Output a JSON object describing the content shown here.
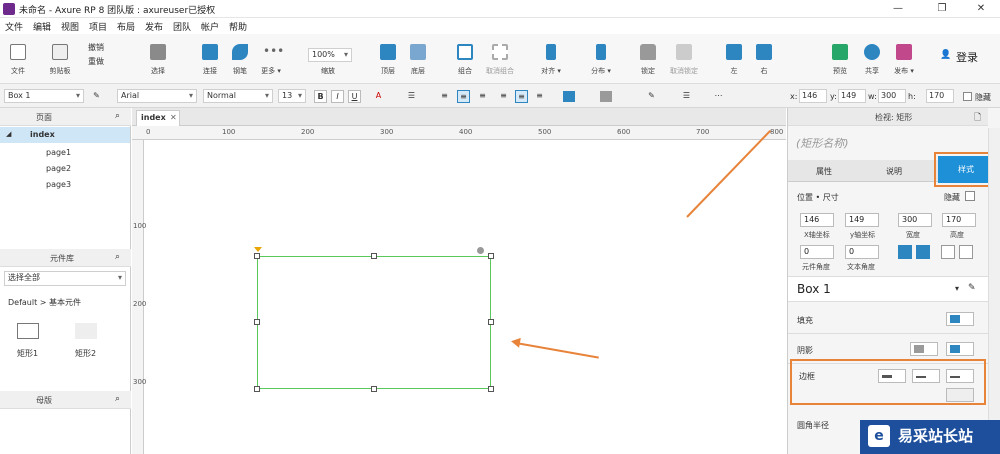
{
  "titlebar": {
    "title": "未命名 - Axure RP 8 团队版 : axureuser已授权",
    "min": "—",
    "max": "❐",
    "close": "✕"
  },
  "menu": [
    "文件",
    "编辑",
    "视图",
    "项目",
    "布局",
    "发布",
    "团队",
    "帐户",
    "帮助"
  ],
  "toolbar": {
    "file": "文件",
    "clipboard": "剪贴板",
    "undo": "撤销",
    "redo": "重做",
    "select": "选择",
    "connect": "连接",
    "pen": "钢笔",
    "more": "更多 ▾",
    "zoom_value": "100%",
    "zoom_label": "缩放",
    "top": "顶层",
    "bottom": "底层",
    "group": "组合",
    "ungroup": "取消组合",
    "align": "对齐 ▾",
    "distribute": "分布 ▾",
    "lock": "锁定",
    "unlock": "取消锁定",
    "left": "左",
    "right": "右",
    "preview": "预览",
    "share": "共享",
    "publish": "发布 ▾",
    "login": "登录"
  },
  "format": {
    "shape_name": "Box 1",
    "font": "Arial",
    "style": "Normal",
    "size": "13",
    "x_label": "x:",
    "x": "146",
    "y_label": "y:",
    "y": "149",
    "w_label": "w:",
    "w": "300",
    "h_label": "h:",
    "h": "170",
    "hide": "隐藏"
  },
  "pages_panel": {
    "title": "页面",
    "items": [
      "index",
      "page1",
      "page2",
      "page3"
    ]
  },
  "library_panel": {
    "title": "元件库",
    "select": "选择全部",
    "group": "Default > 基本元件",
    "w1": "矩形1",
    "w2": "矩形2"
  },
  "masters_panel": {
    "title": "母版"
  },
  "canvas": {
    "tab": "index",
    "ruler_top": [
      "0",
      "100",
      "200",
      "300",
      "400",
      "500",
      "600",
      "700",
      "800"
    ],
    "ruler_left": [
      "100",
      "200",
      "300"
    ]
  },
  "inspector": {
    "title": "检视: 矩形",
    "name_placeholder": "(矩形名称)",
    "tabs": [
      "属性",
      "说明",
      "样式"
    ],
    "pos_size": "位置 • 尺寸",
    "hide": "隐藏",
    "x": "146",
    "y": "149",
    "w": "300",
    "h": "170",
    "x_label": "X轴坐标",
    "y_label": "y轴坐标",
    "w_label": "宽度",
    "h_label": "高度",
    "rot": "0",
    "trot": "0",
    "rot_label": "元件角度",
    "trot_label": "文本角度",
    "style_name": "Box 1",
    "fill": "填充",
    "shadow": "阴影",
    "border": "边框",
    "corner": "圆角半径"
  },
  "watermark": {
    "text": "易采站长站"
  },
  "colors": {
    "accent": "#1e90d8",
    "highlight": "#e8833a",
    "shape_border": "#5ac85a"
  }
}
